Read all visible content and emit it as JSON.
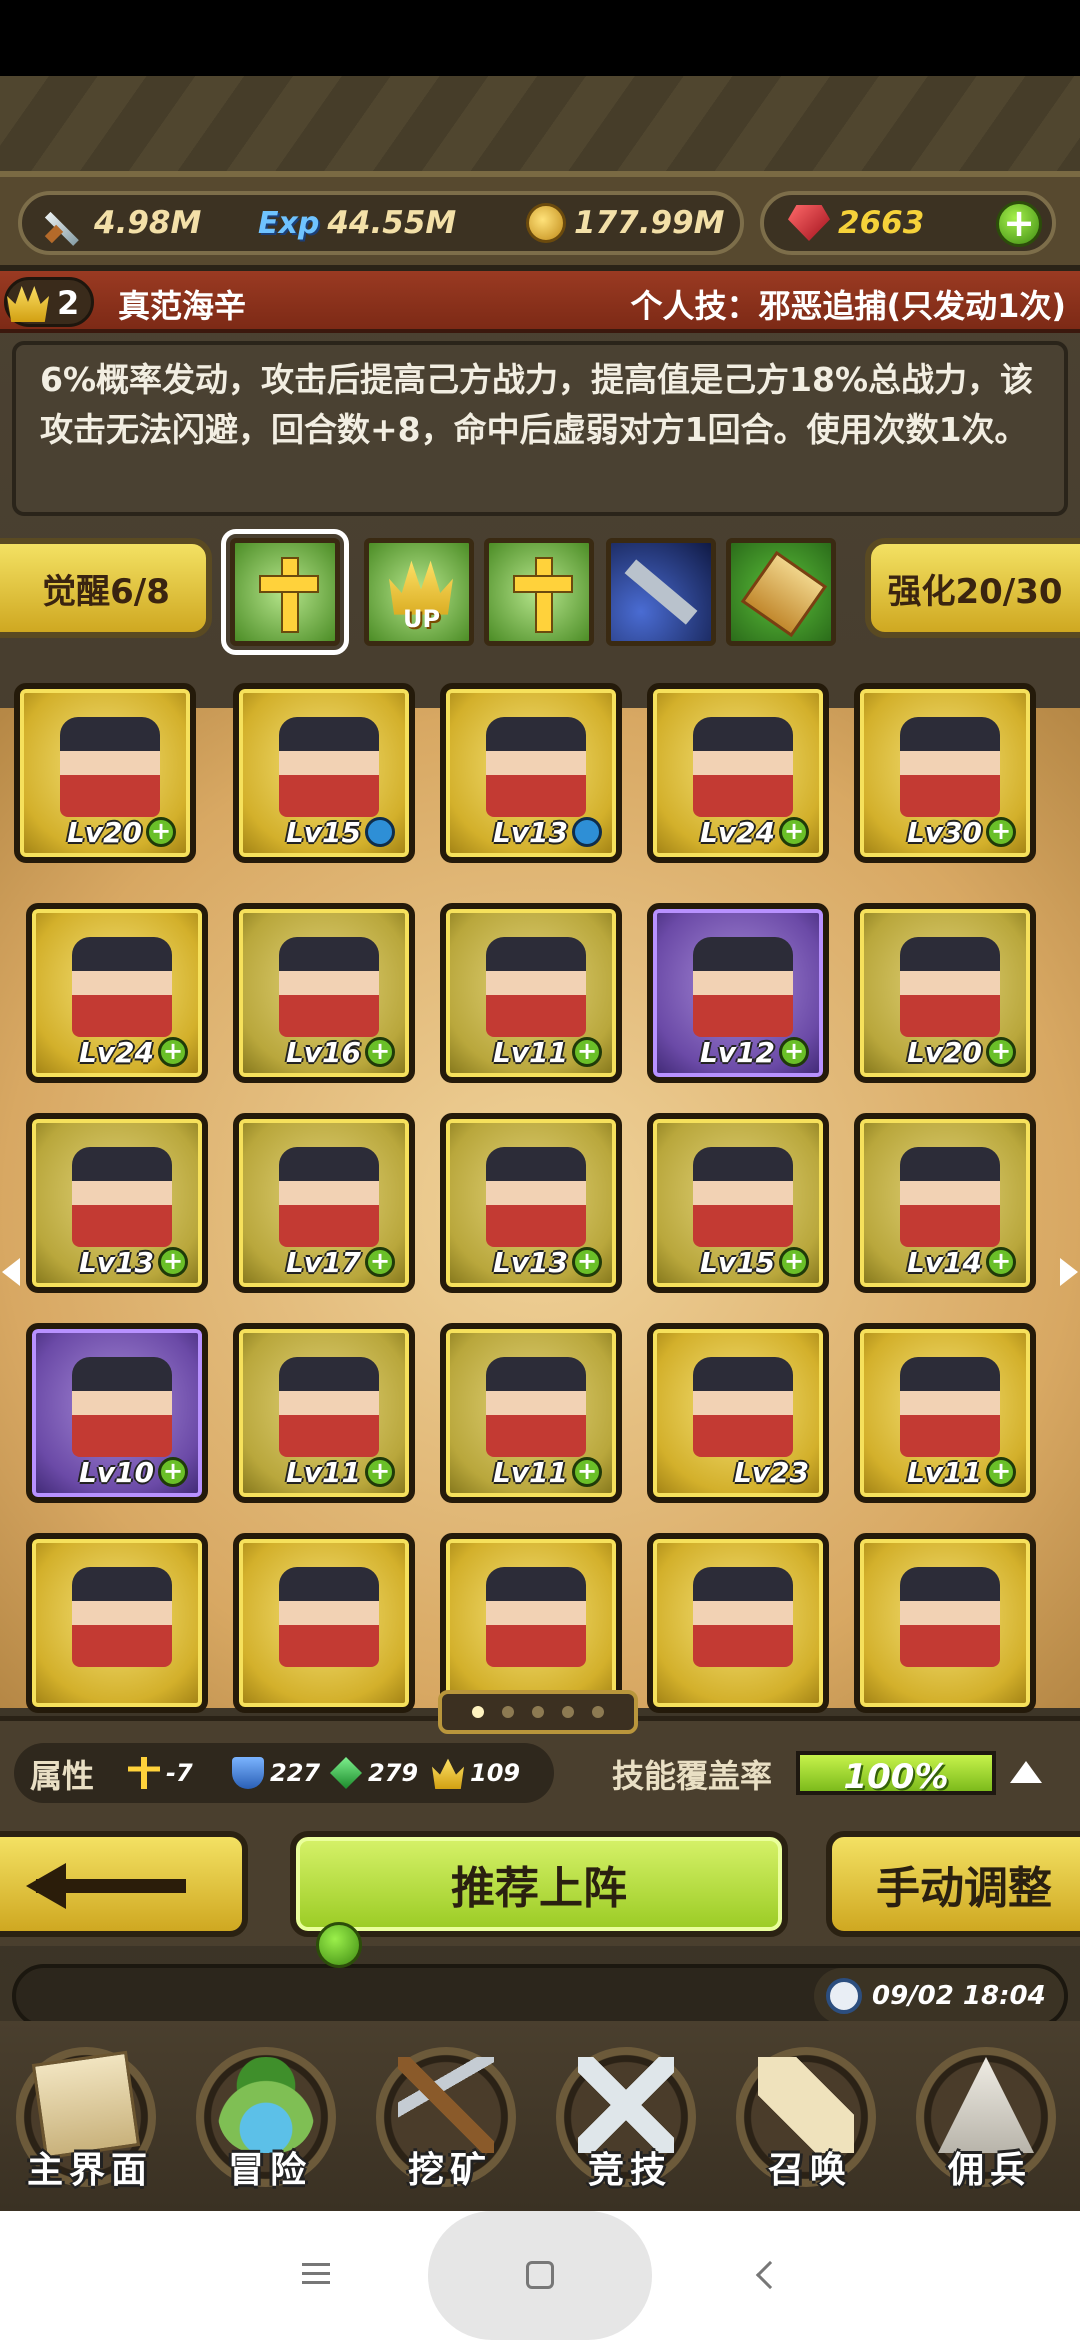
{
  "resources": {
    "power": "4.98M",
    "exp_label": "Exp",
    "exp": "44.55M",
    "gold": "177.99M",
    "gems": "2663"
  },
  "hero": {
    "rank": "2",
    "name": "真范海辛",
    "personal_skill": "个人技：邪恶追捕(只发动1次)",
    "description": "6%概率发动，攻击后提高己方战力，提高值是己方18%总战力，该攻击无法闪避，回合数+8，命中后虚弱对方1回合。使用次数1次。"
  },
  "awaken": {
    "label": "觉醒6/8"
  },
  "strengthen": {
    "label": "强化20/30"
  },
  "skill_slots": [
    {
      "icon": "holy-cross-icon",
      "selected": true
    },
    {
      "icon": "crown-up-icon",
      "up_text": "UP"
    },
    {
      "icon": "holy-cross-handshake-icon"
    },
    {
      "icon": "musket-icon"
    },
    {
      "icon": "scroll-bundle-icon"
    }
  ],
  "heroes": [
    {
      "lv": "Lv20",
      "badge": "plus",
      "style": "gold"
    },
    {
      "lv": "Lv15",
      "badge": "star",
      "style": "gold"
    },
    {
      "lv": "Lv13",
      "badge": "star",
      "style": "gold"
    },
    {
      "lv": "Lv24",
      "badge": "plus",
      "style": "gold"
    },
    {
      "lv": "Lv30",
      "badge": "plus",
      "style": "gold"
    },
    {
      "lv": "Lv24",
      "badge": "plus",
      "style": "gold"
    },
    {
      "lv": "Lv16",
      "badge": "plus",
      "style": "olive"
    },
    {
      "lv": "Lv11",
      "badge": "plus",
      "style": "olive"
    },
    {
      "lv": "Lv12",
      "badge": "plus",
      "style": "purple"
    },
    {
      "lv": "Lv20",
      "badge": "plus",
      "style": "olive"
    },
    {
      "lv": "Lv13",
      "badge": "plus",
      "style": "olive"
    },
    {
      "lv": "Lv17",
      "badge": "plus",
      "style": "olive"
    },
    {
      "lv": "Lv13",
      "badge": "plus",
      "style": "olive"
    },
    {
      "lv": "Lv15",
      "badge": "plus",
      "style": "olive"
    },
    {
      "lv": "Lv14",
      "badge": "plus",
      "style": "olive"
    },
    {
      "lv": "Lv10",
      "badge": "plus",
      "style": "purple"
    },
    {
      "lv": "Lv11",
      "badge": "plus",
      "style": "olive"
    },
    {
      "lv": "Lv11",
      "badge": "plus",
      "style": "olive"
    },
    {
      "lv": "Lv23",
      "badge": "none",
      "style": "gold"
    },
    {
      "lv": "Lv11",
      "badge": "plus",
      "style": "gold"
    },
    {
      "lv": "",
      "badge": "none",
      "style": "gold"
    },
    {
      "lv": "",
      "badge": "none",
      "style": "gold"
    },
    {
      "lv": "",
      "badge": "none",
      "style": "gold"
    },
    {
      "lv": "",
      "badge": "none",
      "style": "gold"
    },
    {
      "lv": "",
      "badge": "none",
      "style": "gold"
    }
  ],
  "pager": {
    "pages": 5,
    "active": 0
  },
  "attributes": {
    "label": "属性",
    "cross": "-7",
    "shield": "227",
    "gem": "279",
    "crown": "109",
    "coverage_label": "技能覆盖率",
    "coverage_value": "100%",
    "coverage_fraction": 1.0
  },
  "actions": {
    "recommend": "推荐上阵",
    "manual": "手动调整"
  },
  "clock": "09/02 18:04",
  "nav": [
    {
      "label": "主界面",
      "icon": "map-scroll-icon"
    },
    {
      "label": "冒险",
      "icon": "island-icon"
    },
    {
      "label": "挖矿",
      "icon": "pickaxe-icon"
    },
    {
      "label": "竞技",
      "icon": "crossed-swords-icon"
    },
    {
      "label": "召唤",
      "icon": "summon-scroll-icon"
    },
    {
      "label": "佣兵",
      "icon": "tent-icon"
    }
  ]
}
